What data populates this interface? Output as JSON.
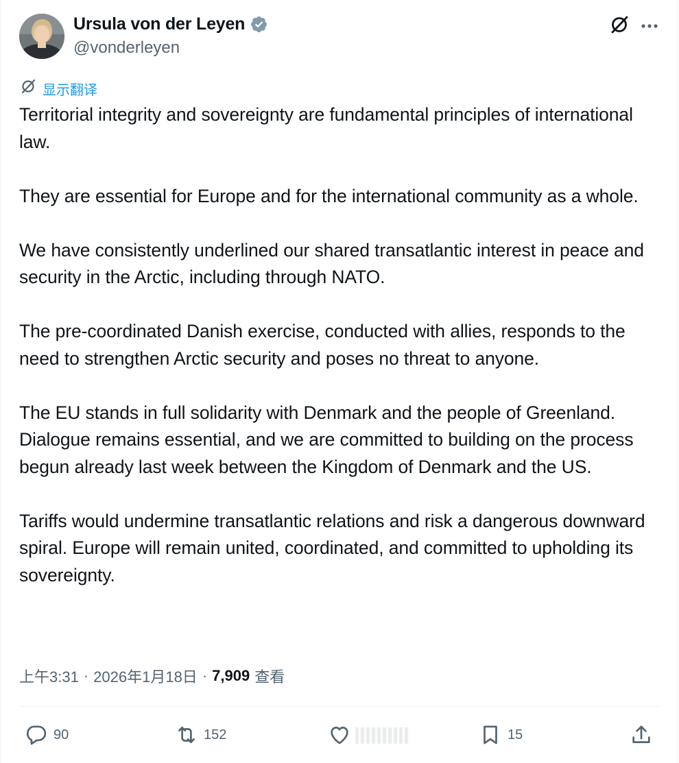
{
  "author": {
    "display_name": "Ursula von der Leyen",
    "handle": "@vonderleyen",
    "verified": true
  },
  "header": {
    "grok_icon": "grok-icon",
    "more_icon": "more-icon"
  },
  "translate_label": "显示翻译",
  "tweet": {
    "paragraphs": [
      "Territorial integrity and sovereignty are fundamental principles of international law.",
      "They are essential for Europe and for the international community as a whole.",
      "We have consistently underlined our shared transatlantic interest in peace and security in the Arctic, including through NATO.",
      "The pre-coordinated Danish exercise, conducted with allies, responds to the need to strengthen Arctic security and poses no threat to anyone.",
      "The EU stands in full solidarity with Denmark and the people of Greenland. Dialogue remains essential, and we are committed to building on the process begun already last week between  the Kingdom of Denmark and the US.",
      "Tariffs would undermine transatlantic relations and risk a dangerous downward spiral. Europe will remain united, coordinated, and committed to upholding its sovereignty."
    ]
  },
  "meta": {
    "time": "上午3:31",
    "separator": "·",
    "date": "2026年1月18日",
    "views_count": "7,909",
    "views_label": "查看"
  },
  "actions": {
    "replies": "90",
    "reposts": "152",
    "likes": "",
    "bookmarks": "15"
  },
  "colors": {
    "accent": "#1d9bf0",
    "text": "#0f1419",
    "secondary": "#536471",
    "verified_badge": "#829aab"
  }
}
